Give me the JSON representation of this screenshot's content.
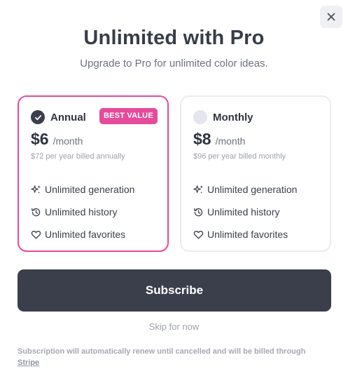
{
  "modal": {
    "title": "Unlimited with Pro",
    "subtitle": "Upgrade to Pro for unlimited color ideas."
  },
  "plans": [
    {
      "name": "Annual",
      "selected": true,
      "badge": "BEST VALUE",
      "price": "$6",
      "period": "/month",
      "billed": "$72 per year billed annually",
      "features": [
        "Unlimited generation",
        "Unlimited history",
        "Unlimited favorites"
      ]
    },
    {
      "name": "Monthly",
      "selected": false,
      "price": "$8",
      "period": "/month",
      "billed": "$96 per year billed monthly",
      "features": [
        "Unlimited generation",
        "Unlimited history",
        "Unlimited favorites"
      ]
    }
  ],
  "actions": {
    "subscribe_label": "Subscribe",
    "skip_label": "Skip for now"
  },
  "footnote": {
    "text": "Subscription will automatically renew until cancelled and will be billed through ",
    "link": "Stripe"
  },
  "colors": {
    "accent": "#e64a9b",
    "primary": "#3a3f4b",
    "muted": "#9ca1ab"
  },
  "icons": {
    "close": "close-icon",
    "check": "check-icon",
    "generation": "sparkles-icon",
    "history": "history-icon",
    "favorites": "heart-icon"
  }
}
